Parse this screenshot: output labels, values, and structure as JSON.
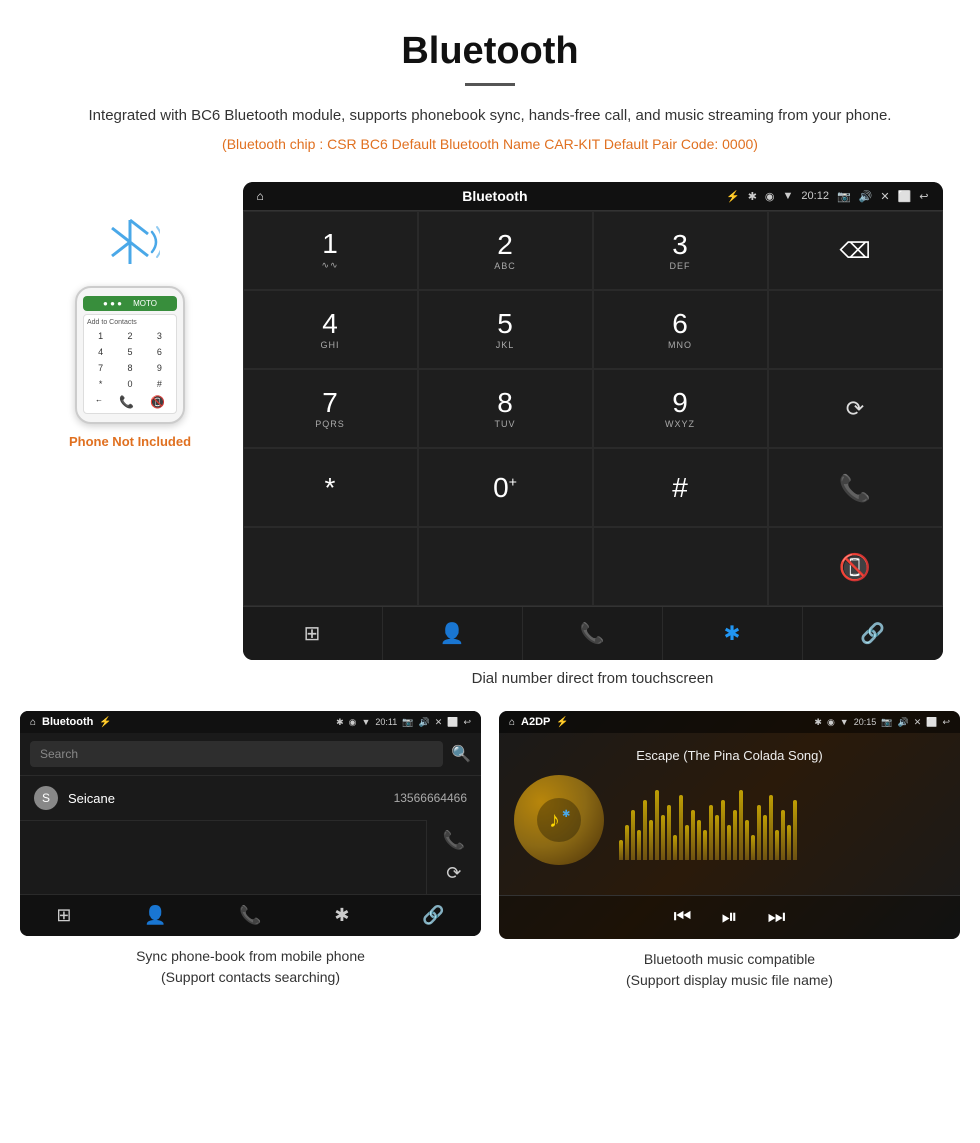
{
  "header": {
    "title": "Bluetooth",
    "description": "Integrated with BC6 Bluetooth module, supports phonebook sync, hands-free call, and music streaming from your phone.",
    "specs": "(Bluetooth chip : CSR BC6    Default Bluetooth Name CAR-KIT    Default Pair Code: 0000)"
  },
  "phone_not_included": "Phone Not Included",
  "dial_screen": {
    "title": "Bluetooth",
    "time": "20:12",
    "keys": [
      {
        "num": "1",
        "sub": "∿∿"
      },
      {
        "num": "2",
        "sub": "ABC"
      },
      {
        "num": "3",
        "sub": "DEF"
      },
      {
        "num": "",
        "sub": ""
      },
      {
        "num": "4",
        "sub": "GHI"
      },
      {
        "num": "5",
        "sub": "JKL"
      },
      {
        "num": "6",
        "sub": "MNO"
      },
      {
        "num": "",
        "sub": ""
      },
      {
        "num": "7",
        "sub": "PQRS"
      },
      {
        "num": "8",
        "sub": "TUV"
      },
      {
        "num": "9",
        "sub": "WXYZ"
      },
      {
        "num": "⟳",
        "sub": ""
      },
      {
        "num": "*",
        "sub": ""
      },
      {
        "num": "0⁺",
        "sub": ""
      },
      {
        "num": "#",
        "sub": ""
      },
      {
        "num": "📞",
        "sub": "call"
      },
      {
        "num": "📵",
        "sub": "end"
      }
    ],
    "bottom_icons": [
      "⊞",
      "👤",
      "📞",
      "✱",
      "🔗"
    ],
    "caption": "Dial number direct from touchscreen"
  },
  "phonebook_screen": {
    "title": "Bluetooth",
    "time": "20:11",
    "search_placeholder": "Search",
    "contact": {
      "letter": "S",
      "name": "Seicane",
      "phone": "13566664466"
    },
    "caption_line1": "Sync phone-book from mobile phone",
    "caption_line2": "(Support contacts searching)"
  },
  "music_screen": {
    "title": "A2DP",
    "time": "20:15",
    "song_title": "Escape (The Pina Colada Song)",
    "caption_line1": "Bluetooth music compatible",
    "caption_line2": "(Support display music file name)"
  },
  "icons": {
    "home": "⌂",
    "usb": "⚡",
    "bluetooth": "✱",
    "location": "◉",
    "wifi": "▼",
    "camera": "📷",
    "volume": "🔊",
    "close_x": "✕",
    "screen": "⬜",
    "back": "↩",
    "backspace": "⌫",
    "call": "📞",
    "end_call": "📵",
    "refresh": "⟳",
    "grid": "⊞",
    "person": "👤",
    "phone": "📞",
    "bt_star": "✱",
    "link": "🔗",
    "search": "🔍",
    "prev": "⏮",
    "play_pause": "⏯",
    "next": "⏭",
    "music_note": "♪"
  }
}
